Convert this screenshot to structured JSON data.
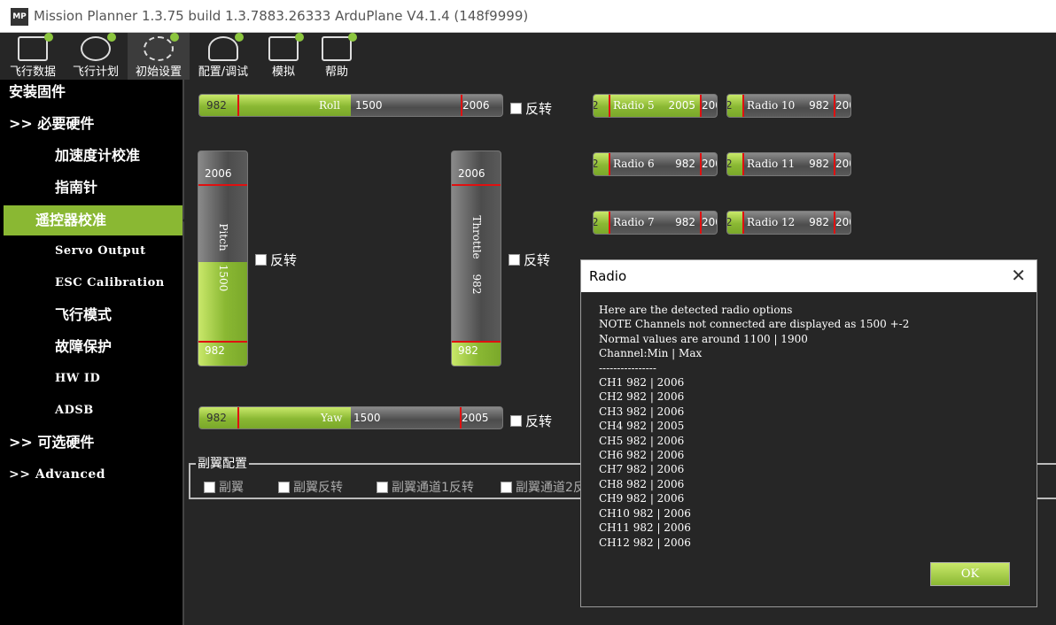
{
  "window": {
    "title": "Mission Planner 1.3.75 build 1.3.7883.26333 ArduPlane V4.1.4 (148f9999)",
    "logo": "MP"
  },
  "toolbar": [
    {
      "label": "飞行数据",
      "icon": "flight-data-icon"
    },
    {
      "label": "飞行计划",
      "icon": "flight-plan-icon"
    },
    {
      "label": "初始设置",
      "icon": "initial-setup-icon"
    },
    {
      "label": "配置/调试",
      "icon": "config-tuning-icon"
    },
    {
      "label": "模拟",
      "icon": "simulation-icon"
    },
    {
      "label": "帮助",
      "icon": "help-icon"
    }
  ],
  "sidebar": {
    "items": [
      {
        "label": "安装固件"
      },
      {
        "label": ">> 必要硬件"
      },
      {
        "label": "加速度计校准"
      },
      {
        "label": "指南针"
      },
      {
        "label": "遥控器校准"
      },
      {
        "label": "Servo Output"
      },
      {
        "label": "ESC Calibration"
      },
      {
        "label": "飞行模式"
      },
      {
        "label": "故障保护"
      },
      {
        "label": "HW ID"
      },
      {
        "label": "ADSB"
      },
      {
        "label": ">> 可选硬件"
      },
      {
        "label": ">> Advanced"
      }
    ]
  },
  "channels": {
    "roll": {
      "name": "Roll",
      "min": "982",
      "value": "1500",
      "max": "2006",
      "fill": 0.505
    },
    "pitch": {
      "name": "Pitch",
      "min": "982",
      "value": "1500",
      "max": "2006",
      "fill": 0.505
    },
    "throttle": {
      "name": "Throttle",
      "min": "982",
      "value": "982",
      "max": "2006",
      "fill": 0
    },
    "yaw": {
      "name": "Yaw",
      "min": "982",
      "value": "1500",
      "max": "2005",
      "fill": 0.505
    },
    "reverse_label": "反转"
  },
  "radios": [
    {
      "name": "Radio 5",
      "value": "2005",
      "min": "2",
      "max": "200",
      "fill": 1
    },
    {
      "name": "Radio 6",
      "value": "982",
      "min": "2",
      "max": "200",
      "fill": 0
    },
    {
      "name": "Radio 7",
      "value": "982",
      "min": "2",
      "max": "200",
      "fill": 0
    },
    {
      "name": "Radio 10",
      "value": "982",
      "min": "2",
      "max": "200",
      "fill": 0
    },
    {
      "name": "Radio 11",
      "value": "982",
      "min": "2",
      "max": "200",
      "fill": 0
    },
    {
      "name": "Radio 12",
      "value": "982",
      "min": "2",
      "max": "200",
      "fill": 0
    }
  ],
  "aileron": {
    "title": "副翼配置",
    "options": [
      "副翼",
      "副翼反转",
      "副翼通道1反转",
      "副翼通道2反"
    ]
  },
  "dialog": {
    "title": "Radio",
    "lines": [
      "Here are the detected radio options",
      "NOTE Channels not connected are displayed as 1500 +-2",
      "Normal values are around 1100 | 1900",
      "Channel:Min | Max",
      "----------------",
      "CH1 982 | 2006",
      "CH2 982 | 2006",
      "CH3 982 | 2006",
      "CH4 982 | 2005",
      "CH5 982 | 2006",
      "CH6 982 | 2006",
      "CH7 982 | 2006",
      "CH8 982 | 2006",
      "CH9 982 | 2006",
      "CH10 982 | 2006",
      "CH11 982 | 2006",
      "CH12 982 | 2006"
    ],
    "ok": "OK"
  },
  "colors": {
    "accent": "#8ab833",
    "marker": "#e01010",
    "background": "#262626"
  }
}
